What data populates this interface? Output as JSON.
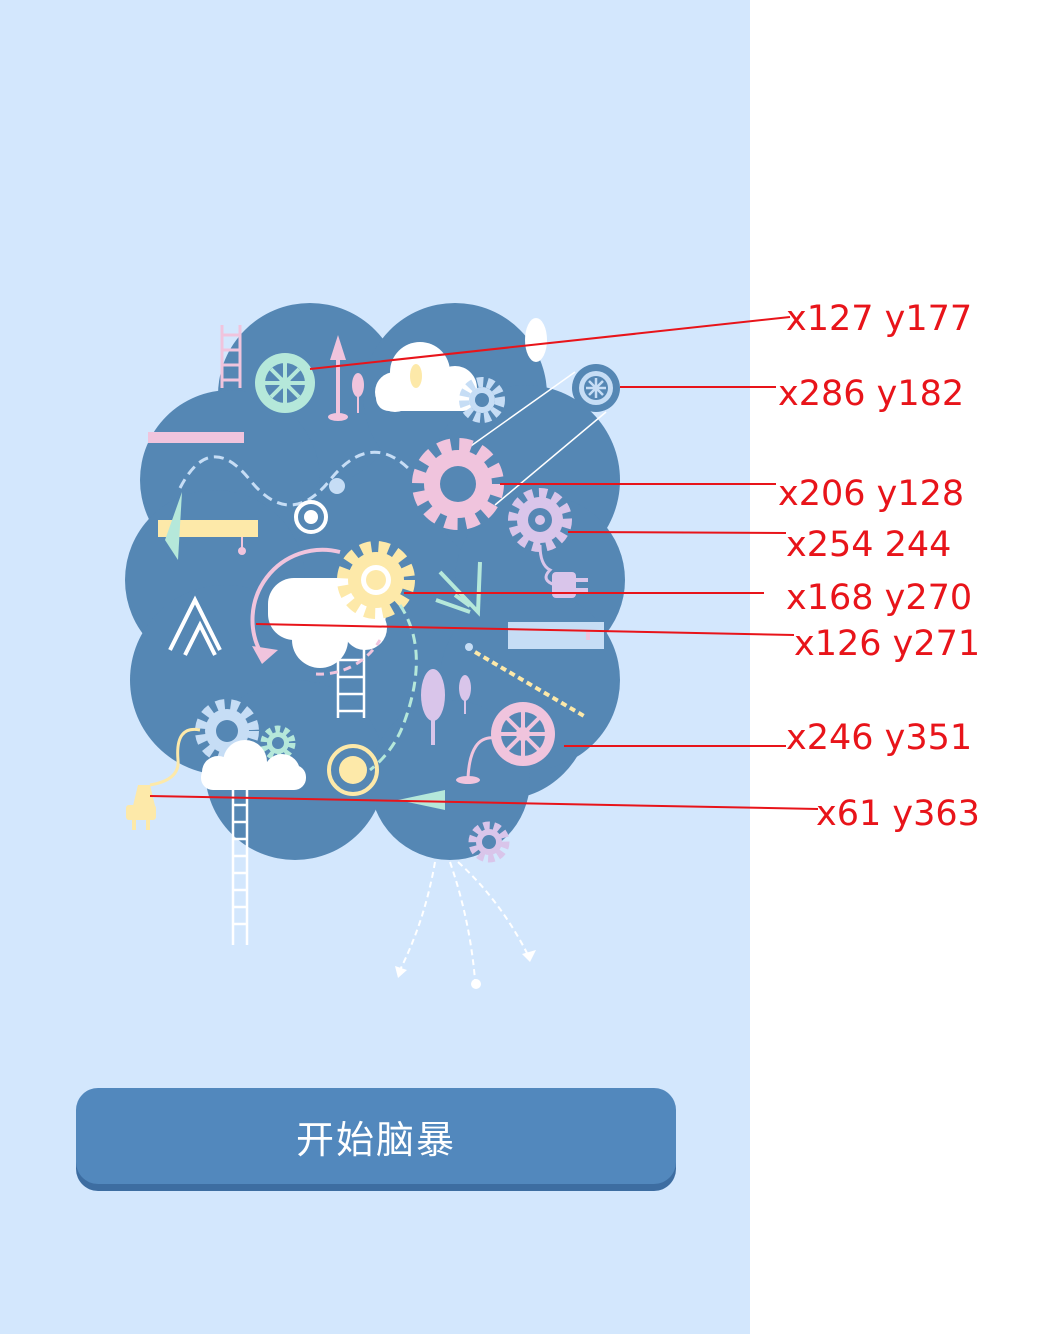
{
  "app": {
    "start_button_label": "开始脑暴"
  },
  "annotations": [
    {
      "text": "x127 y177"
    },
    {
      "text": "x286 y182"
    },
    {
      "text": "x206 y128"
    },
    {
      "text": "x254 244"
    },
    {
      "text": "x168 y270"
    },
    {
      "text": "x126 y271"
    },
    {
      "text": "x246 y351"
    },
    {
      "text": "x61 y363"
    }
  ],
  "icons": {
    "brain_cloud": "brain-cloud-illustration",
    "gears": [
      "mint-wheel-icon",
      "pink-gear-icon",
      "lavender-gear-icon",
      "yellow-gear-icon",
      "blue-gear-icon",
      "pink-wheel-icon",
      "lavender-small-gear-icon",
      "small-blue-wheel-icon"
    ],
    "plugs": [
      "yellow-plug-icon",
      "lavender-plug-icon"
    ]
  },
  "colors": {
    "panel_background": "#d3e7fd",
    "cloud": "#5587b4",
    "button": "#5288bd",
    "annotation": "#e8141a",
    "pink": "#f0c4dd",
    "mint": "#b5e8da",
    "lavender": "#d9c5ea",
    "yellow": "#fde9a9",
    "light_blue": "#c6ddf5"
  }
}
